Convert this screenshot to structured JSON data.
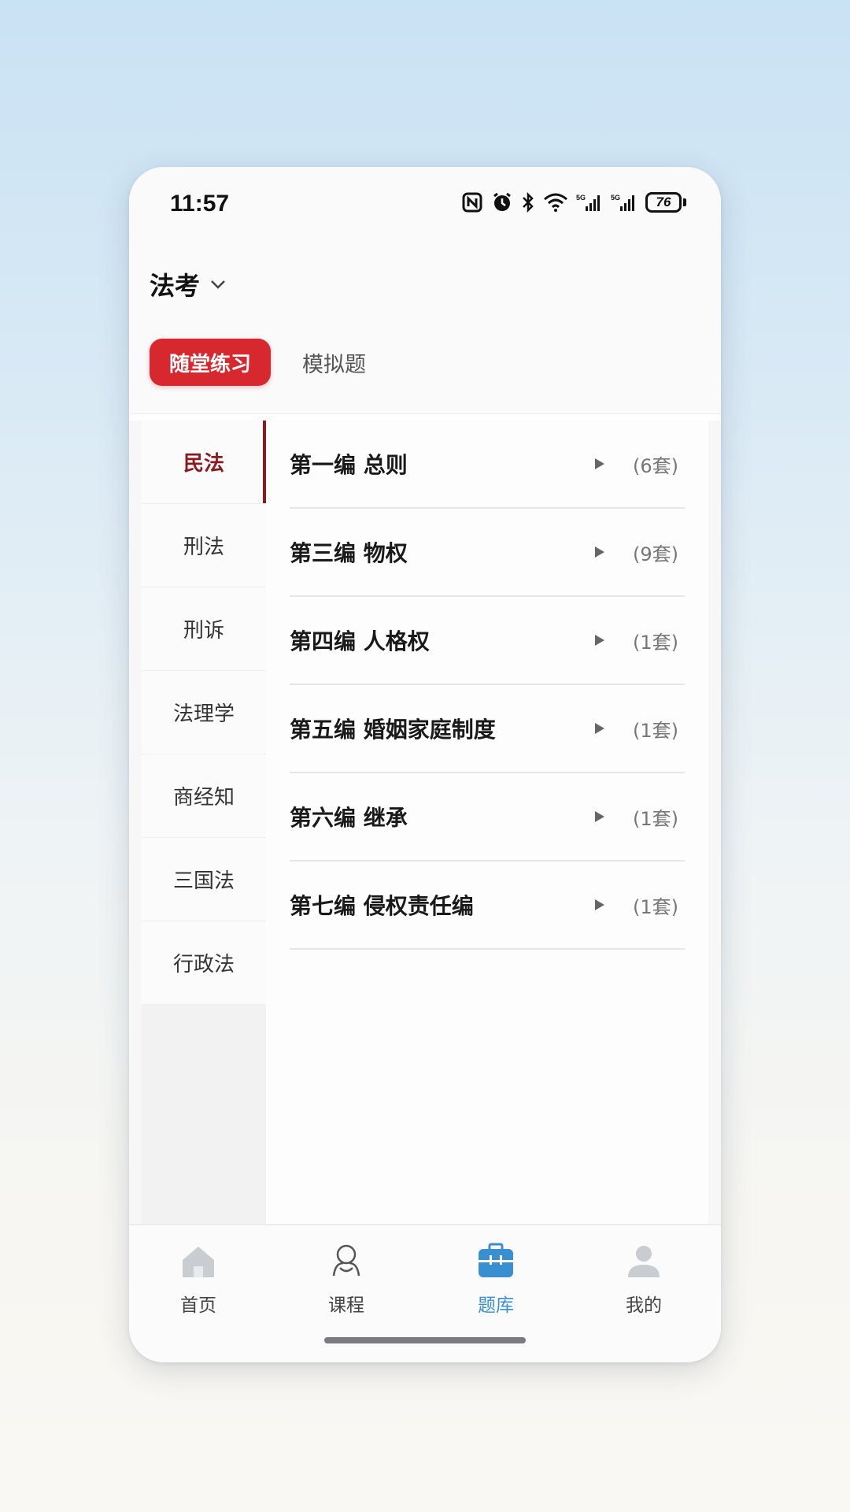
{
  "status_bar": {
    "time": "11:57",
    "battery": "76",
    "icons": [
      "nfc-icon",
      "alarm-icon",
      "bluetooth-icon",
      "wifi-icon",
      "signal-5g-icon",
      "signal-5g-icon"
    ]
  },
  "header": {
    "exam_title": "法考"
  },
  "tabs": [
    {
      "label": "随堂练习",
      "active": true
    },
    {
      "label": "模拟题",
      "active": false
    }
  ],
  "sidebar": {
    "items": [
      {
        "label": "民法",
        "active": true
      },
      {
        "label": "刑法",
        "active": false
      },
      {
        "label": "刑诉",
        "active": false
      },
      {
        "label": "法理学",
        "active": false
      },
      {
        "label": "商经知",
        "active": false
      },
      {
        "label": "三国法",
        "active": false
      },
      {
        "label": "行政法",
        "active": false
      }
    ]
  },
  "list": {
    "items": [
      {
        "title": "第一编 总则",
        "count": "(6套)"
      },
      {
        "title": "第三编 物权",
        "count": "(9套)"
      },
      {
        "title": "第四编 人格权",
        "count": "(1套)"
      },
      {
        "title": "第五编 婚姻家庭制度",
        "count": "(1套)"
      },
      {
        "title": "第六编 继承",
        "count": "(1套)"
      },
      {
        "title": "第七编 侵权责任编",
        "count": "(1套)"
      }
    ]
  },
  "bottom_nav": {
    "items": [
      {
        "label": "首页",
        "icon": "home-icon",
        "active": false
      },
      {
        "label": "课程",
        "icon": "course-icon",
        "active": false
      },
      {
        "label": "题库",
        "icon": "question-bank-icon",
        "active": true
      },
      {
        "label": "我的",
        "icon": "profile-icon",
        "active": false
      }
    ]
  },
  "colors": {
    "accent_red": "#d7272f",
    "sidebar_active": "#8b1a1f",
    "nav_active": "#3a8fd0"
  }
}
